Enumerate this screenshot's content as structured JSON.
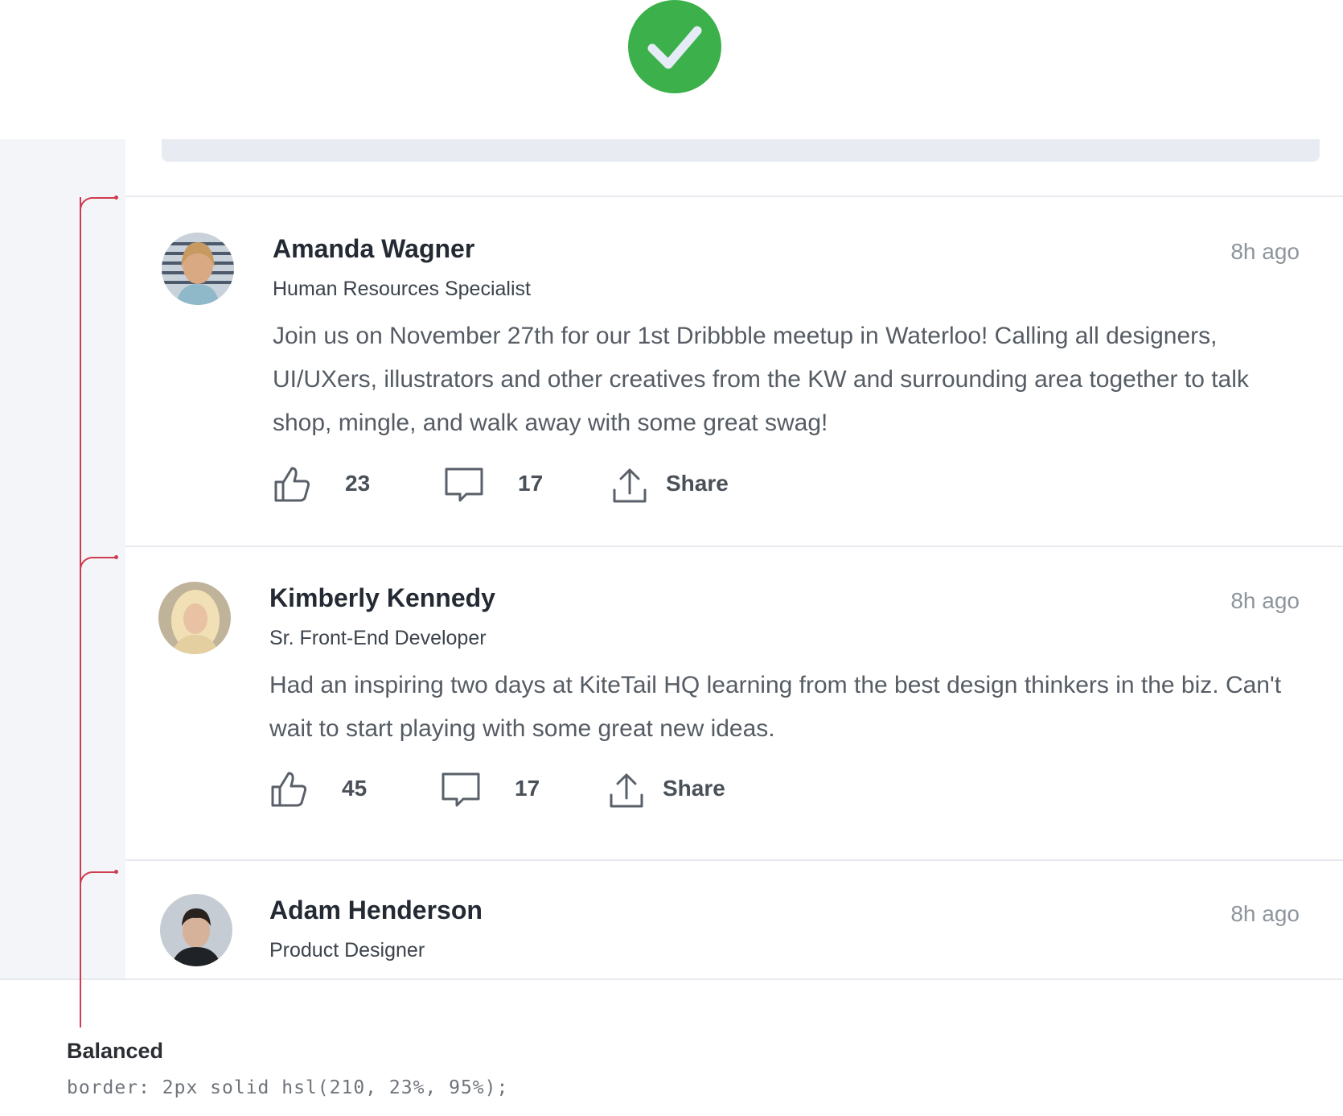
{
  "status": {
    "icon": "check-circle-icon",
    "color": "#3cb04a"
  },
  "thread": {
    "color": "#cf3b4f"
  },
  "posts": [
    {
      "author": "Amanda Wagner",
      "role": "Human Resources Specialist",
      "time": "8h ago",
      "body": "Join us on November 27th for our 1st Dribbble meetup in Waterloo! Calling all designers, UI/UXers, illustrators and other creatives from the KW and surrounding area together to talk shop, mingle, and walk away with some great swag!",
      "likes": "23",
      "comments": "17",
      "share_label": "Share"
    },
    {
      "author": "Kimberly Kennedy",
      "role": "Sr. Front-End Developer",
      "time": "8h ago",
      "body": "Had an inspiring two days at KiteTail HQ learning from the best design thinkers in the biz. Can't wait to start playing with some great new ideas.",
      "likes": "45",
      "comments": "17",
      "share_label": "Share"
    },
    {
      "author": "Adam Henderson",
      "role": "Product Designer",
      "time": "8h ago"
    }
  ],
  "caption": {
    "title": "Balanced",
    "code": "border: 2px solid hsl(210, 23%, 95%);"
  }
}
